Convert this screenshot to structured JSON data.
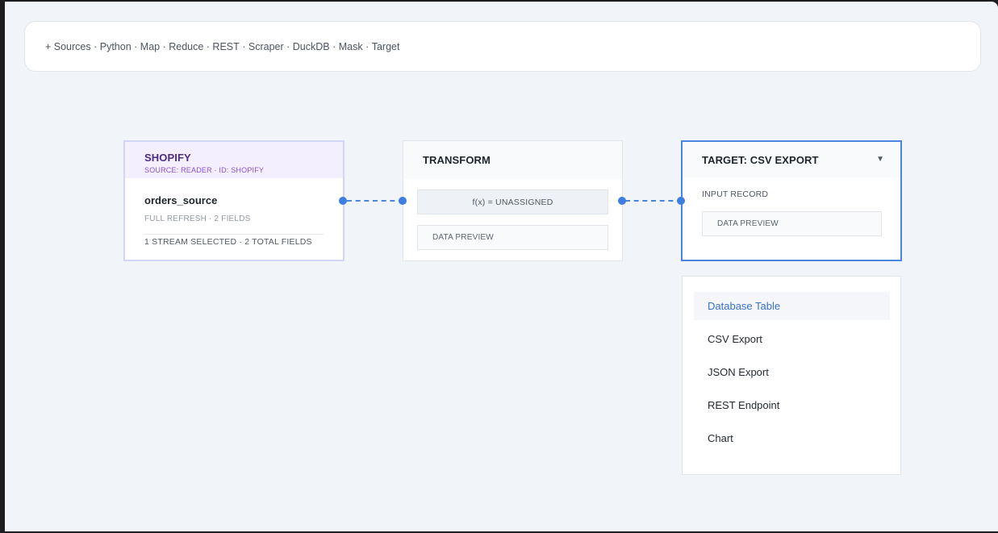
{
  "toolbar": {
    "items": [
      "+ Sources",
      "Python",
      "Map",
      "Reduce",
      "REST",
      "Scraper",
      "DuckDB",
      "Mask",
      "Target"
    ],
    "separator": " · "
  },
  "nodes": {
    "source": {
      "title": "SHOPIFY",
      "subtitle": "SOURCE: READER · ID: SHOPIFY",
      "stream_name": "orders_source",
      "stream_meta": "FULL REFRESH · 2 FIELDS",
      "stream_total": "1 STREAM SELECTED · 2 TOTAL FIELDS"
    },
    "transform": {
      "title": "TRANSFORM",
      "fx_label": "f(x) = UNASSIGNED",
      "preview_label": "DATA PREVIEW"
    },
    "target": {
      "title": "TARGET: CSV EXPORT",
      "chevron_icon": "chevron-down-icon",
      "input_label": "INPUT RECORD",
      "preview_label": "DATA PREVIEW"
    }
  },
  "dropdown": {
    "selected": "Database Table",
    "options": [
      "Database Table",
      "CSV Export",
      "JSON Export",
      "REST Endpoint",
      "Chart"
    ]
  },
  "colors": {
    "accent": "#3d7ee3",
    "source_header_bg": "#f4efff",
    "source_title": "#4e2c84",
    "source_subtitle": "#8c4fd6",
    "canvas_bg": "#f1f4f8"
  }
}
